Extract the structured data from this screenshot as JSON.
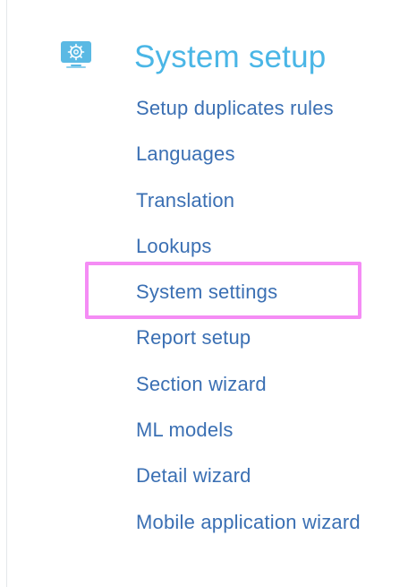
{
  "section": {
    "title": "System setup",
    "icon": "gear-monitor-icon",
    "icon_color": "#5ab9e4",
    "title_color": "#4ab6e6"
  },
  "menu": {
    "link_color": "#3a6fb3",
    "items": [
      {
        "label": "Setup duplicates rules"
      },
      {
        "label": "Languages"
      },
      {
        "label": "Translation"
      },
      {
        "label": "Lookups"
      },
      {
        "label": "System settings",
        "highlighted": true
      },
      {
        "label": "Report setup"
      },
      {
        "label": "Section wizard"
      },
      {
        "label": "ML models"
      },
      {
        "label": "Detail wizard"
      },
      {
        "label": "Mobile application wizard"
      }
    ]
  },
  "highlight": {
    "color": "#f58cf5"
  }
}
